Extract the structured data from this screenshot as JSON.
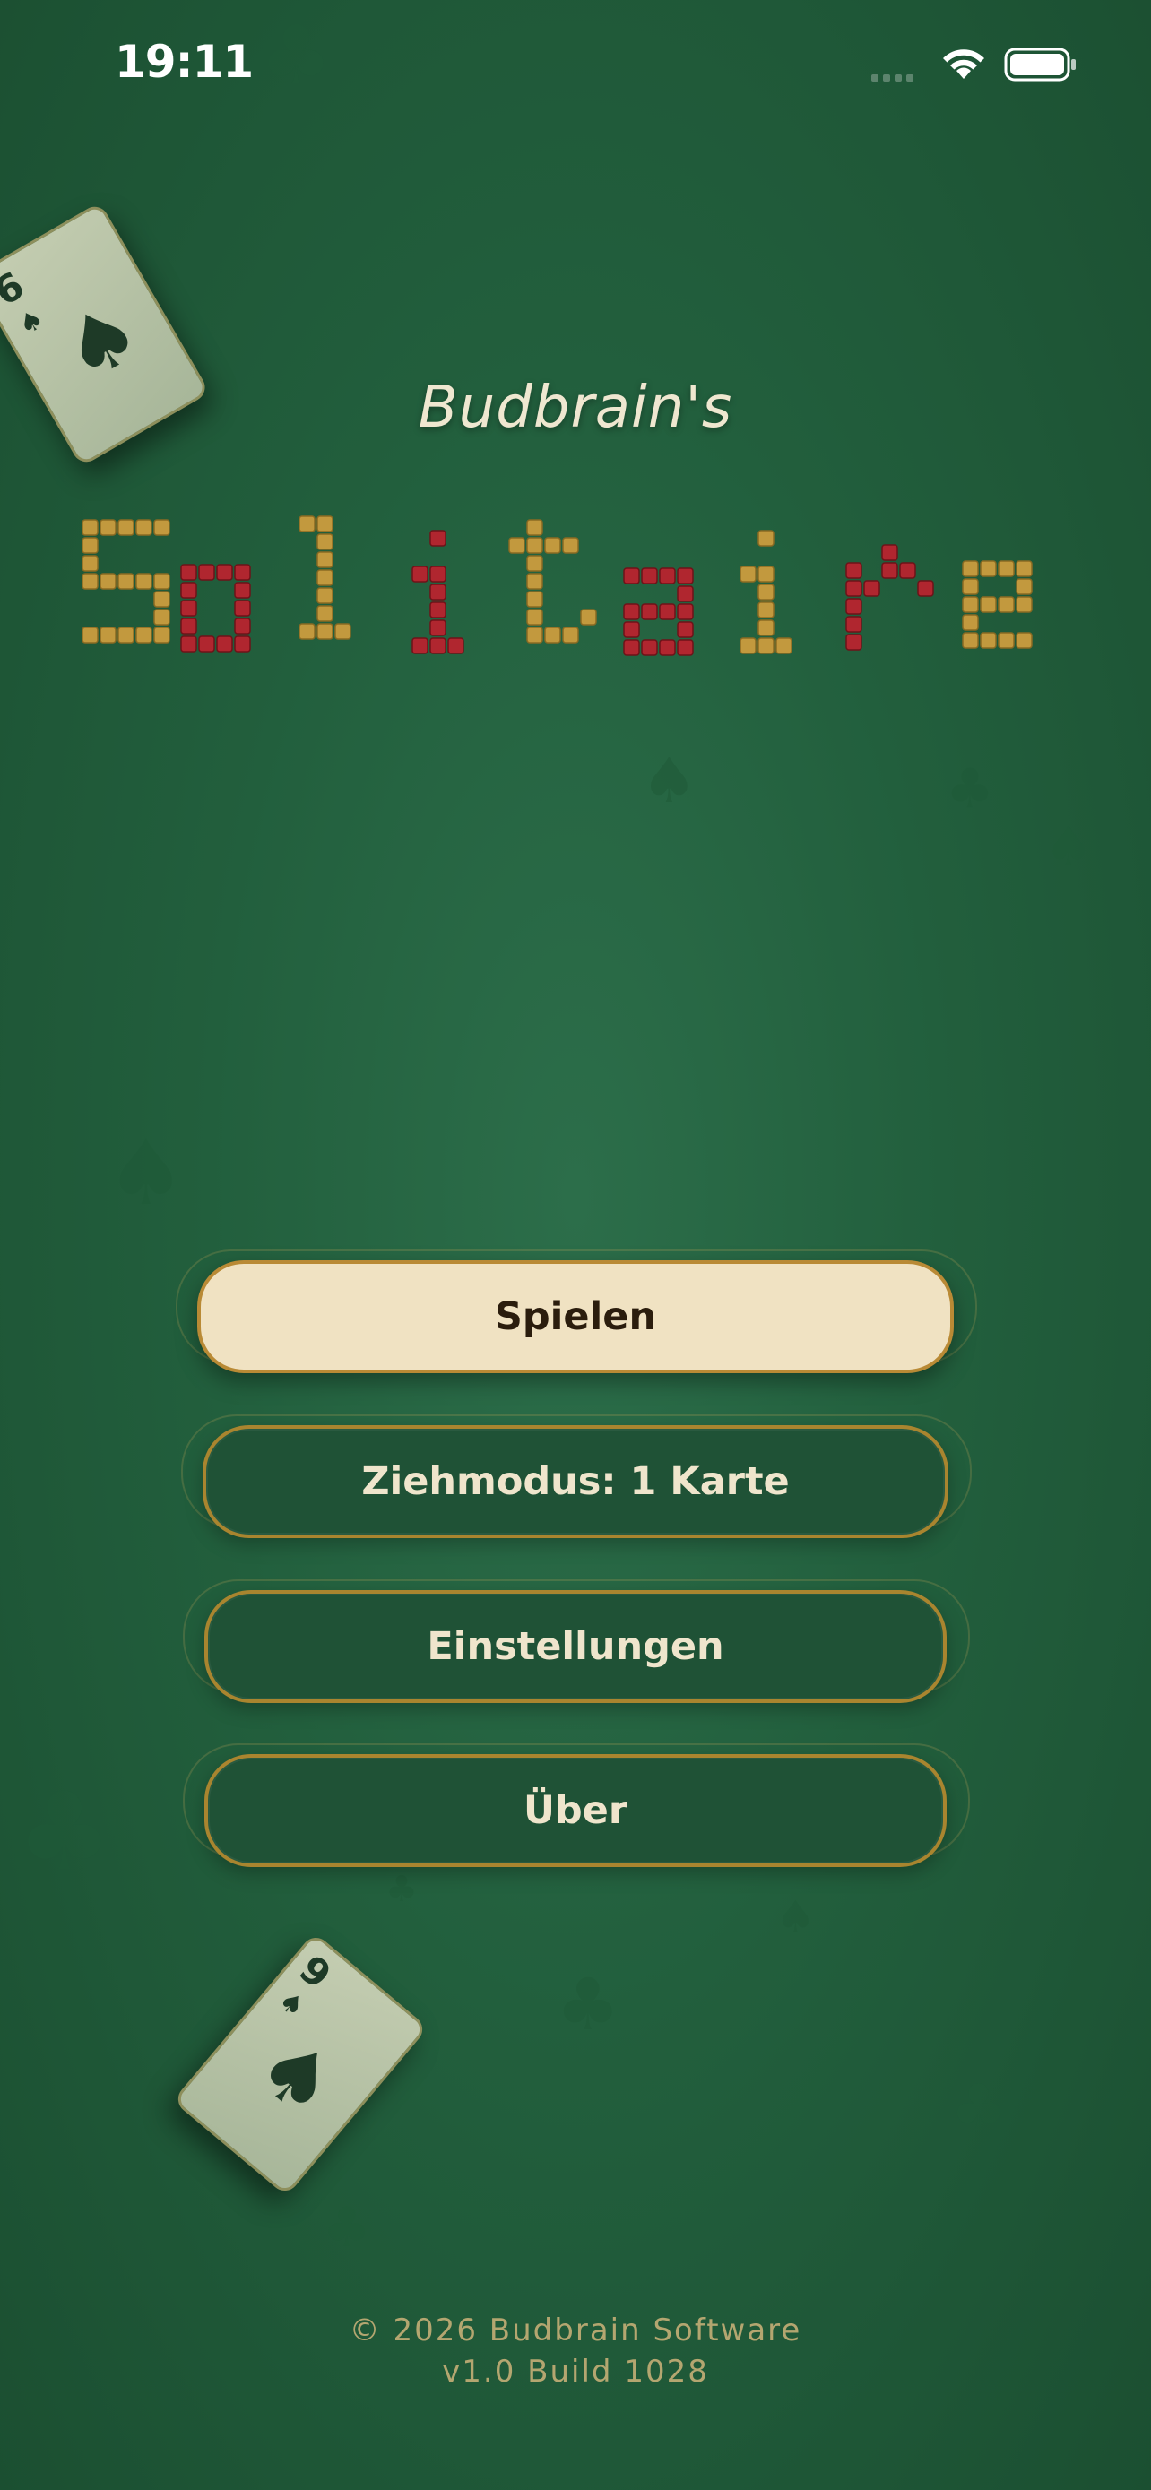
{
  "status": {
    "time": "19:11"
  },
  "title": {
    "subtitle": "Budbrain's",
    "main": "Solitaire"
  },
  "cards": [
    {
      "rank": "6",
      "suit": "♠"
    },
    {
      "rank": "9",
      "suit": "♠"
    }
  ],
  "menu": {
    "play": "Spielen",
    "draw_mode": "Ziehmodus: 1 Karte",
    "settings": "Einstellungen",
    "about": "Über"
  },
  "footer": {
    "copyright": "© 2026 Budbrain Software",
    "version": "v1.0 Build 1028"
  },
  "colors": {
    "felt": "#225f3d",
    "gold": "#b98a35",
    "cream": "#f0e2c2",
    "red": "#b0262f"
  }
}
